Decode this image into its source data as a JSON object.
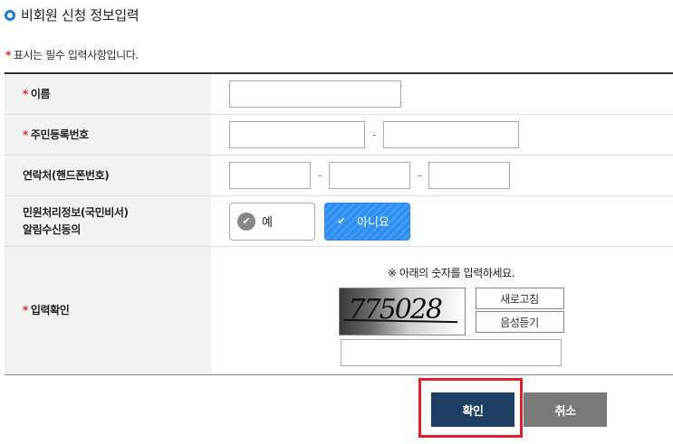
{
  "page": {
    "title": "비회원 신청 정보입력",
    "required_note": "표시는 필수 입력사항입니다."
  },
  "form": {
    "name_label": "이름",
    "rrn_label": "주민등록번호",
    "phone_label": "연락처(핸드폰번호)",
    "consent_label_line1": "민원처리정보(국민비서)",
    "consent_label_line2": "알림수신동의",
    "consent_yes": "예",
    "consent_no": "아니요",
    "consent_selected": "아니요",
    "captcha_label": "입력확인",
    "captcha_guide": "※ 아래의 숫자를 입력하세요.",
    "captcha_text": "775028",
    "refresh_label": "새로고침",
    "audio_label": "음성듣기",
    "dash": "-"
  },
  "buttons": {
    "confirm": "확인",
    "cancel": "취소"
  },
  "colors": {
    "accent": "#1e7be0",
    "required": "#e0262f",
    "confirm_bg": "#1d3f66",
    "cancel_bg": "#7a7a7a",
    "highlight": "#e0202a"
  }
}
